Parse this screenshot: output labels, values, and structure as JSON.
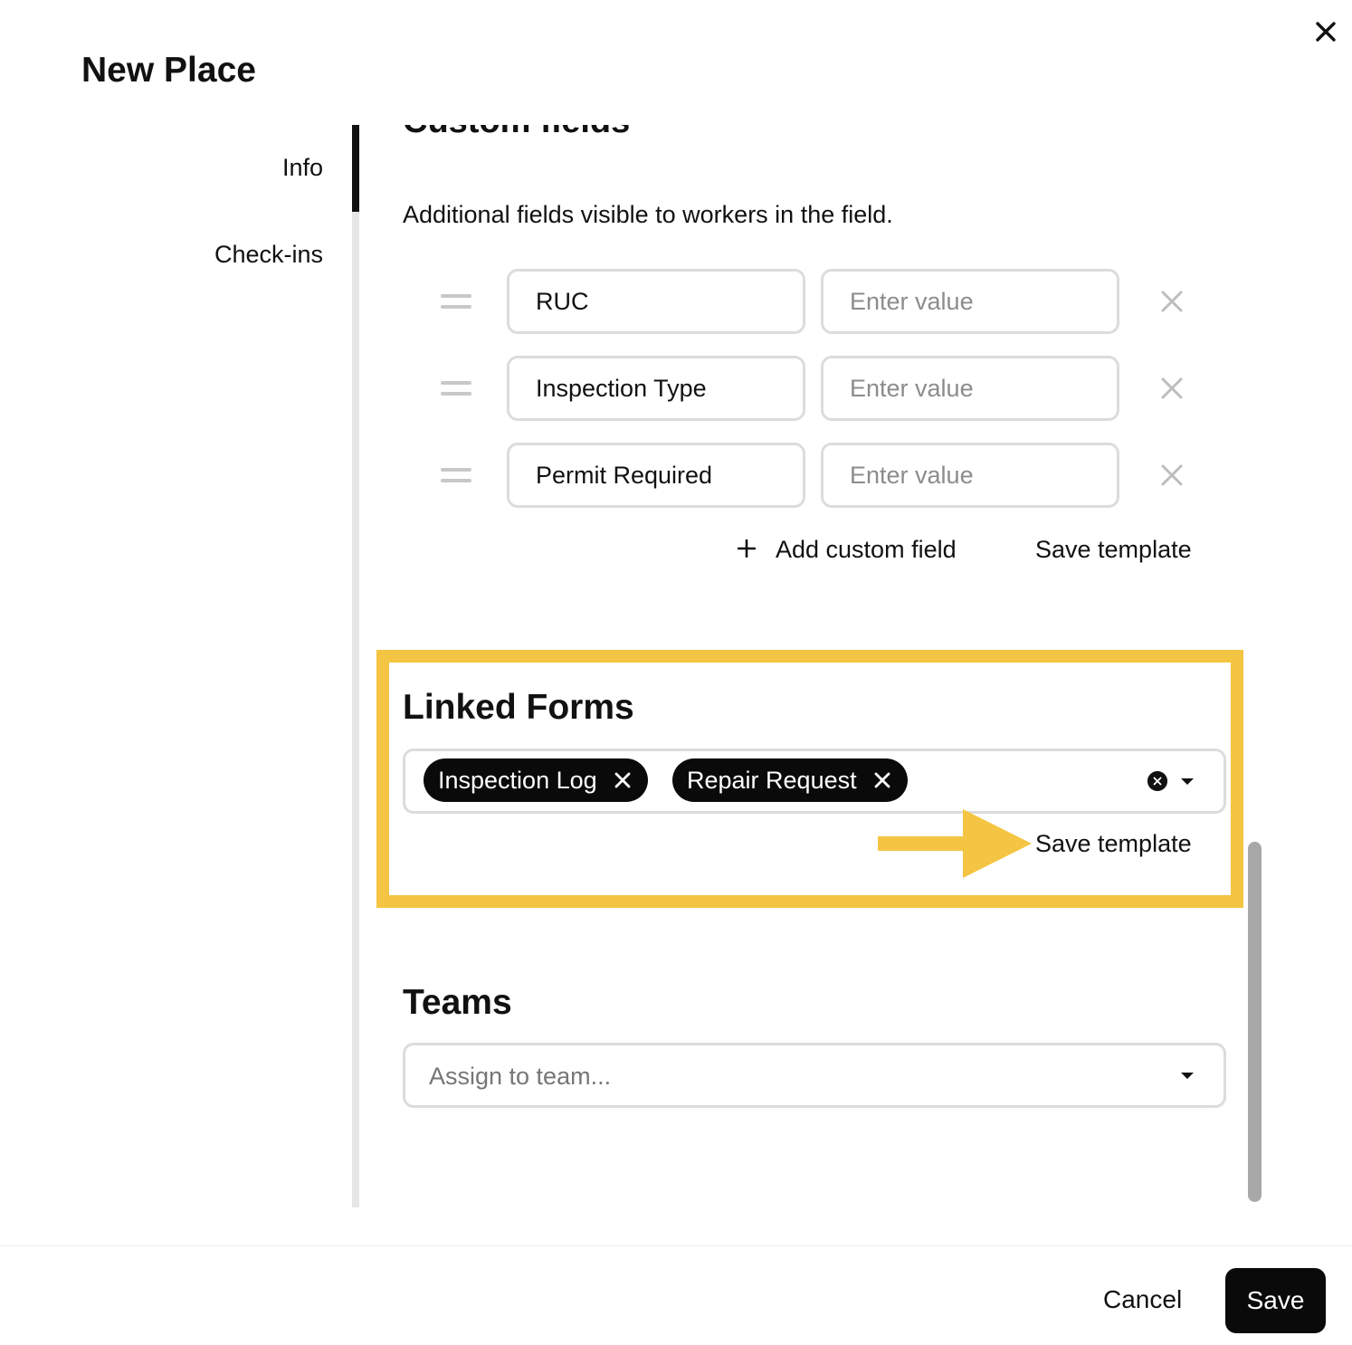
{
  "dialog": {
    "title": "New Place",
    "close_icon": "close-icon"
  },
  "nav": {
    "items": [
      {
        "label": "Info",
        "active": true
      },
      {
        "label": "Check-ins",
        "active": false
      }
    ]
  },
  "custom_fields": {
    "heading": "Custom fields",
    "description": "Additional fields visible to workers in the field.",
    "rows": [
      {
        "name": "RUC",
        "value": "",
        "value_placeholder": "Enter value"
      },
      {
        "name": "Inspection Type",
        "value": "",
        "value_placeholder": "Enter value"
      },
      {
        "name": "Permit Required",
        "value": "",
        "value_placeholder": "Enter value"
      }
    ],
    "add_label": "Add custom field",
    "save_template_label": "Save template"
  },
  "linked_forms": {
    "heading": "Linked Forms",
    "selected": [
      "Inspection Log",
      "Repair Request"
    ],
    "save_template_label": "Save template"
  },
  "teams": {
    "heading": "Teams",
    "placeholder": "Assign to team..."
  },
  "footer": {
    "cancel_label": "Cancel",
    "save_label": "Save"
  },
  "colors": {
    "highlight": "#f4c542",
    "primary_button": "#0a0a0a",
    "border": "#dcdcdc"
  }
}
